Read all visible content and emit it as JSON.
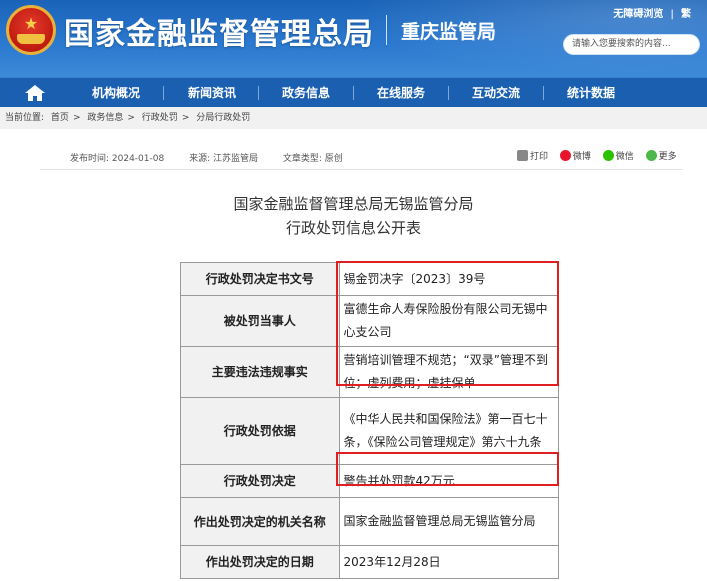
{
  "header": {
    "site_title": "国家金融监督管理总局",
    "branch_name": "重庆监管局",
    "top_links": [
      "无障碍浏览",
      "繁"
    ],
    "search_placeholder": "请输入您要搜索的内容...",
    "colors": {
      "header_blue": "#2a78cf",
      "nav_blue": "#1b5fb0",
      "highlight_red": "#e02020"
    }
  },
  "nav": {
    "home_icon": "home-icon",
    "items": [
      "机构概况",
      "新闻资讯",
      "政务信息",
      "在线服务",
      "互动交流",
      "统计数据"
    ]
  },
  "breadcrumb": {
    "prefix": "当前位置:",
    "items": [
      "首页",
      "政务信息",
      "行政处罚",
      "分局行政处罚"
    ],
    "separator": ">"
  },
  "article": {
    "publish_date": "发布时间: 2024-01-08",
    "source": "来源: 江苏监管局",
    "doc_type": "文章类型: 原创",
    "share": [
      {
        "label": "打印",
        "icon": "print-icon"
      },
      {
        "label": "微博",
        "icon": "weibo-icon"
      },
      {
        "label": "微信",
        "icon": "wechat-icon"
      },
      {
        "label": "更多",
        "icon": "more-icon"
      }
    ],
    "title_line1": "国家金融监督管理总局无锡监管分局",
    "title_line2": "行政处罚信息公开表"
  },
  "table": {
    "rows": [
      {
        "label": "行政处罚决定书文号",
        "value": "锡金罚决字〔2023〕39号"
      },
      {
        "label": "被处罚当事人",
        "value": "富德生命人寿保险股份有限公司无锡中心支公司"
      },
      {
        "label": "主要违法违规事实",
        "value": "营销培训管理不规范；“双录”管理不到位；虚列费用；虚挂保单"
      },
      {
        "label": "行政处罚依据",
        "value": "《中华人民共和国保险法》第一百七十条，《保险公司管理规定》第六十九条"
      },
      {
        "label": "行政处罚决定",
        "value": "警告并处罚款42万元"
      },
      {
        "label": "作出处罚决定的机关名称",
        "value": "国家金融监督管理总局无锡监管分局"
      },
      {
        "label": "作出处罚决定的日期",
        "value": "2023年12月28日"
      }
    ]
  }
}
